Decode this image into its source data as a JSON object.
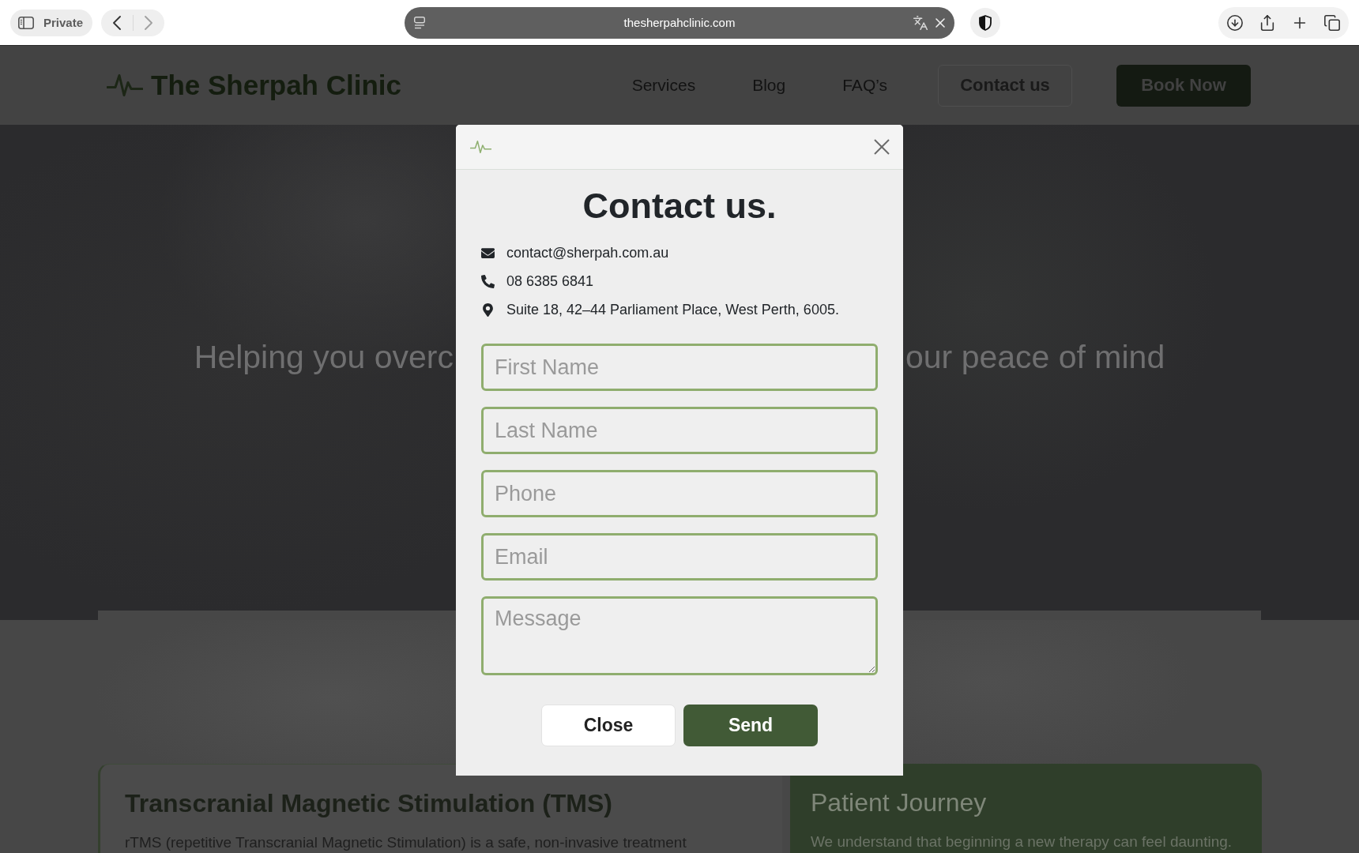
{
  "browser": {
    "private_label": "Private",
    "url": "thesherpahclinic.com"
  },
  "site_header": {
    "logo": "The Sherpah Clinic",
    "nav": [
      {
        "label": "Services"
      },
      {
        "label": "Blog"
      },
      {
        "label": "FAQ’s"
      }
    ],
    "buttons": [
      {
        "label": "Contact us",
        "kind": "outline"
      },
      {
        "label": "Book Now",
        "kind": "filled"
      }
    ]
  },
  "hero": {
    "tagline_parts": [
      "Helping you overc",
      "our peace of mind"
    ]
  },
  "cards": [
    {
      "kind": "plain",
      "title": "Transcranial Magnetic Stimulation (TMS)",
      "text": "rTMS (repetitive Transcranial Magnetic Stimulation) is a safe, non-invasive treatment"
    },
    {
      "kind": "green",
      "title": "Patient Journey",
      "text": "We understand that beginning a new therapy can feel daunting."
    }
  ],
  "modal": {
    "title": "Contact us.",
    "contacts": [
      {
        "kind": "email",
        "text": "contact@sherpah.com.au"
      },
      {
        "kind": "phone",
        "text": "08 6385 6841"
      },
      {
        "kind": "address",
        "text": "Suite 18, 42–44 Parliament Place, West Perth, 6005."
      }
    ],
    "fields": [
      {
        "kind": "input",
        "placeholder": "First Name"
      },
      {
        "kind": "input",
        "placeholder": "Last Name"
      },
      {
        "kind": "input",
        "placeholder": "Phone"
      },
      {
        "kind": "input",
        "placeholder": "Email"
      },
      {
        "kind": "textarea",
        "placeholder": "Message"
      }
    ],
    "buttons": [
      {
        "kind": "secondary",
        "label": "Close"
      },
      {
        "kind": "primary",
        "label": "Send"
      }
    ]
  }
}
